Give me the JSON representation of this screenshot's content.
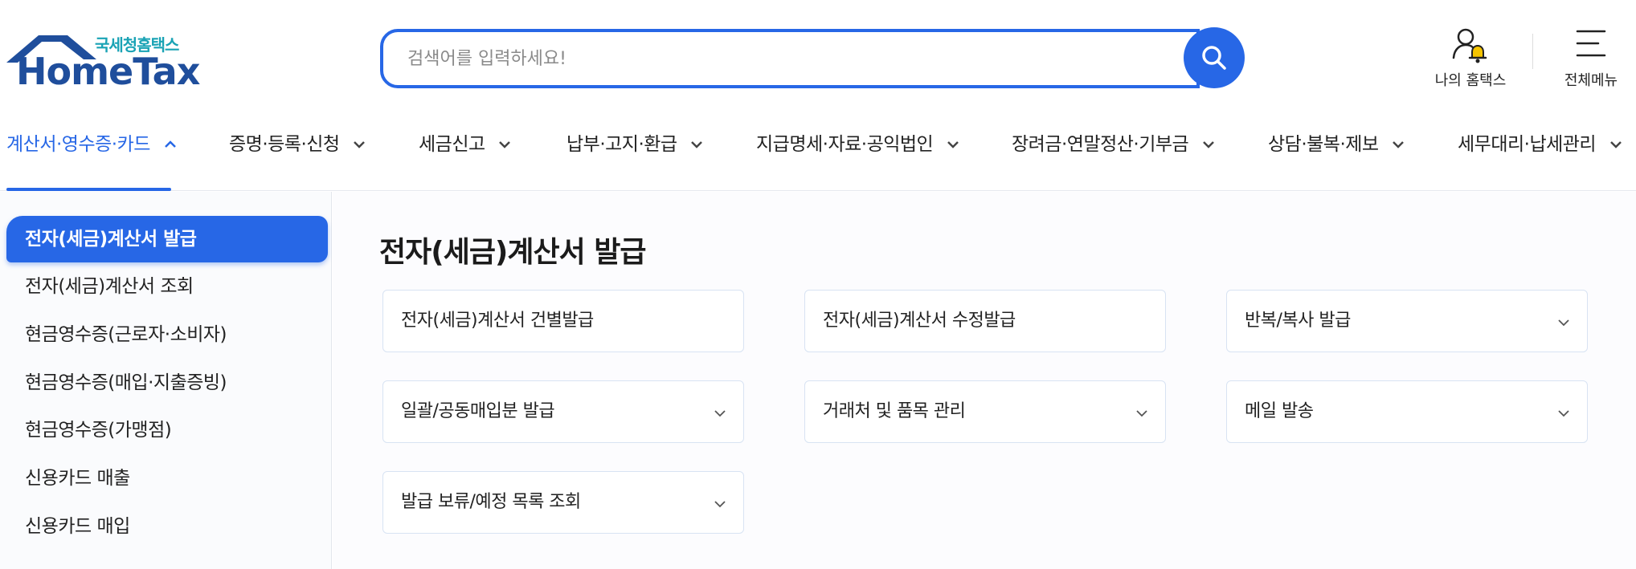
{
  "logo": {
    "sub": "국세청홈택스",
    "main": "HomeTax"
  },
  "search": {
    "placeholder": "검색어를 입력하세요!"
  },
  "header": {
    "my_hometax": "나의 홈택스",
    "all_menu": "전체메뉴"
  },
  "nav": {
    "items": [
      {
        "label": "계산서·영수증·카드",
        "active": true
      },
      {
        "label": "증명·등록·신청"
      },
      {
        "label": "세금신고"
      },
      {
        "label": "납부·고지·환급"
      },
      {
        "label": "지급명세·자료·공익법인"
      },
      {
        "label": "장려금·연말정산·기부금"
      },
      {
        "label": "상담·불복·제보"
      },
      {
        "label": "세무대리·납세관리"
      }
    ]
  },
  "sidebar": {
    "items": [
      {
        "label": "전자(세금)계산서 발급",
        "active": true
      },
      {
        "label": "전자(세금)계산서 조회"
      },
      {
        "label": "현금영수증(근로자·소비자)"
      },
      {
        "label": "현금영수증(매입·지출증빙)"
      },
      {
        "label": "현금영수증(가맹점)"
      },
      {
        "label": "신용카드 매출"
      },
      {
        "label": "신용카드 매입"
      }
    ]
  },
  "main": {
    "title": "전자(세금)계산서 발급",
    "cards": [
      {
        "label": "전자(세금)계산서 건별발급",
        "expandable": false
      },
      {
        "label": "전자(세금)계산서 수정발급",
        "expandable": false
      },
      {
        "label": "반복/복사 발급",
        "expandable": true
      },
      {
        "label": "일괄/공동매입분 발급",
        "expandable": true
      },
      {
        "label": "거래처 및 품목 관리",
        "expandable": true
      },
      {
        "label": "메일 발송",
        "expandable": true
      },
      {
        "label": "발급 보류/예정 목록 조회",
        "expandable": true
      }
    ]
  },
  "colors": {
    "accent": "#2767e6",
    "logo_blue": "#1f4e9c",
    "logo_teal": "#1aa3b5",
    "bell_yellow": "#f5c400"
  },
  "icons": {
    "search": "search-icon",
    "user": "user-bell-icon",
    "menu": "hamburger-icon",
    "chevron": "chevron-down-icon"
  }
}
